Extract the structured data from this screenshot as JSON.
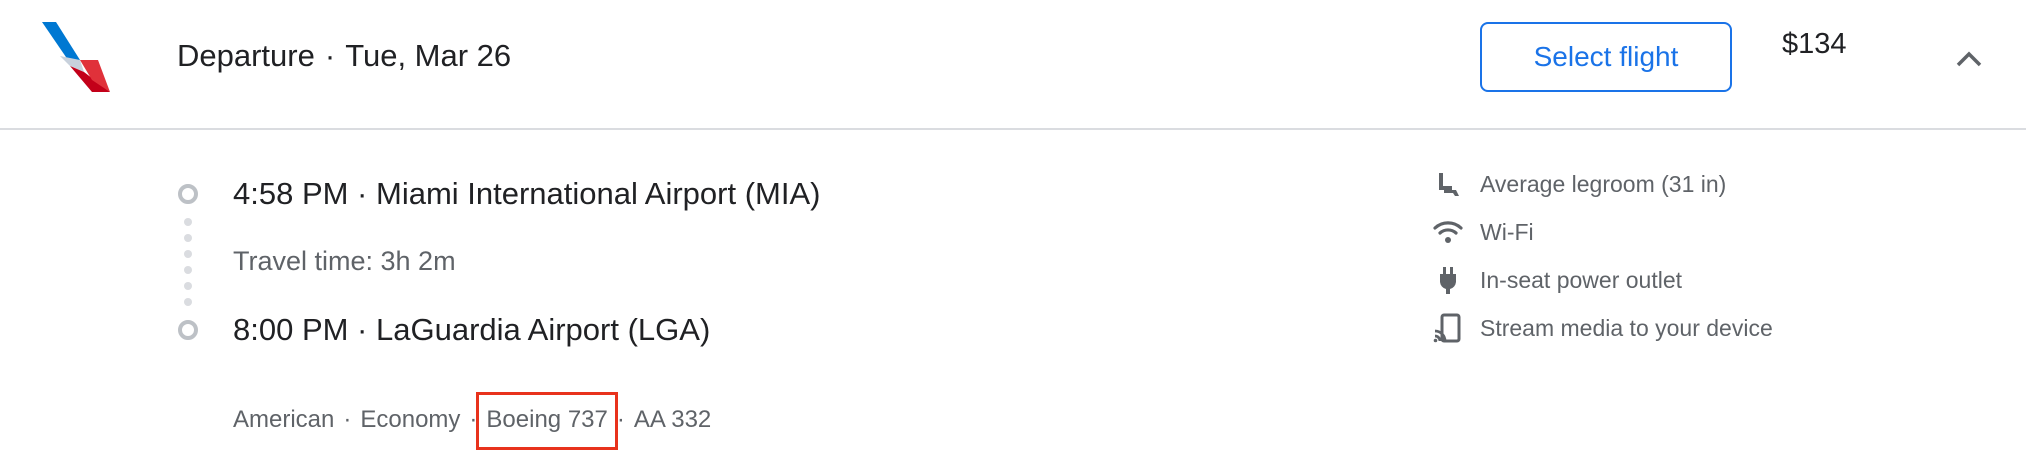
{
  "header": {
    "airline_logo": "american-airlines-logo",
    "direction": "Departure",
    "separator": "·",
    "date": "Tue, Mar 26",
    "select_button_label": "Select flight",
    "price": "$134",
    "collapse_icon": "chevron-up-icon"
  },
  "itinerary": {
    "departure": "4:58 PM · Miami International Airport (MIA)",
    "travel_time": "Travel time: 3h 2m",
    "arrival": "8:00 PM · LaGuardia Airport (LGA)"
  },
  "flight_details": {
    "airline": "American",
    "cabin": "Economy",
    "aircraft": "Boeing 737",
    "flight_number": "AA 332",
    "separator": "·"
  },
  "amenities": [
    {
      "icon": "seat-icon",
      "label": "Average legroom (31 in)"
    },
    {
      "icon": "wifi-icon",
      "label": "Wi-Fi"
    },
    {
      "icon": "power-plug-icon",
      "label": "In-seat power outlet"
    },
    {
      "icon": "cast-icon",
      "label": "Stream media to your device"
    }
  ],
  "colors": {
    "accent": "#1a73e8",
    "highlight": "#e8321c",
    "text_primary": "#202124",
    "text_secondary": "#5f6368"
  }
}
